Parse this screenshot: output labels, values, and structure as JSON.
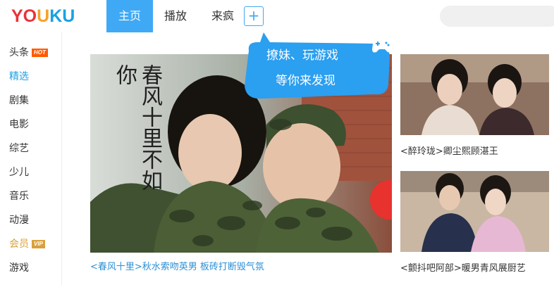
{
  "logo": {
    "part1": "YO",
    "part2": "U",
    "part3": "KU"
  },
  "nav": {
    "tabs": [
      {
        "label": "主页"
      },
      {
        "label": "播放"
      },
      {
        "label": "来疯"
      }
    ],
    "plus_label": "+"
  },
  "sidebar": {
    "items": [
      {
        "label": "头条",
        "badge": "HOT"
      },
      {
        "label": "精选"
      },
      {
        "label": "剧集"
      },
      {
        "label": "电影"
      },
      {
        "label": "综艺"
      },
      {
        "label": "少儿"
      },
      {
        "label": "音乐"
      },
      {
        "label": "动漫"
      },
      {
        "label": "会员",
        "badge": "VIP"
      },
      {
        "label": "游戏"
      }
    ]
  },
  "promo": {
    "line1": "撩妹、玩游戏",
    "line2": "等你来发现"
  },
  "main_feature": {
    "poster_text": "春风十里不如你",
    "caption": "<春风十里>秋水索吻英男 板砖打断毁气氛"
  },
  "side_features": [
    {
      "caption": "<醉玲珑>卿尘熙顾湛王"
    },
    {
      "caption": "<颤抖吧阿部>暖男青风展厨艺"
    }
  ],
  "colors": {
    "accent": "#3fa9f5",
    "link": "#2d8fd5",
    "hot": "#ff5a00",
    "vip": "#d9a13b"
  }
}
